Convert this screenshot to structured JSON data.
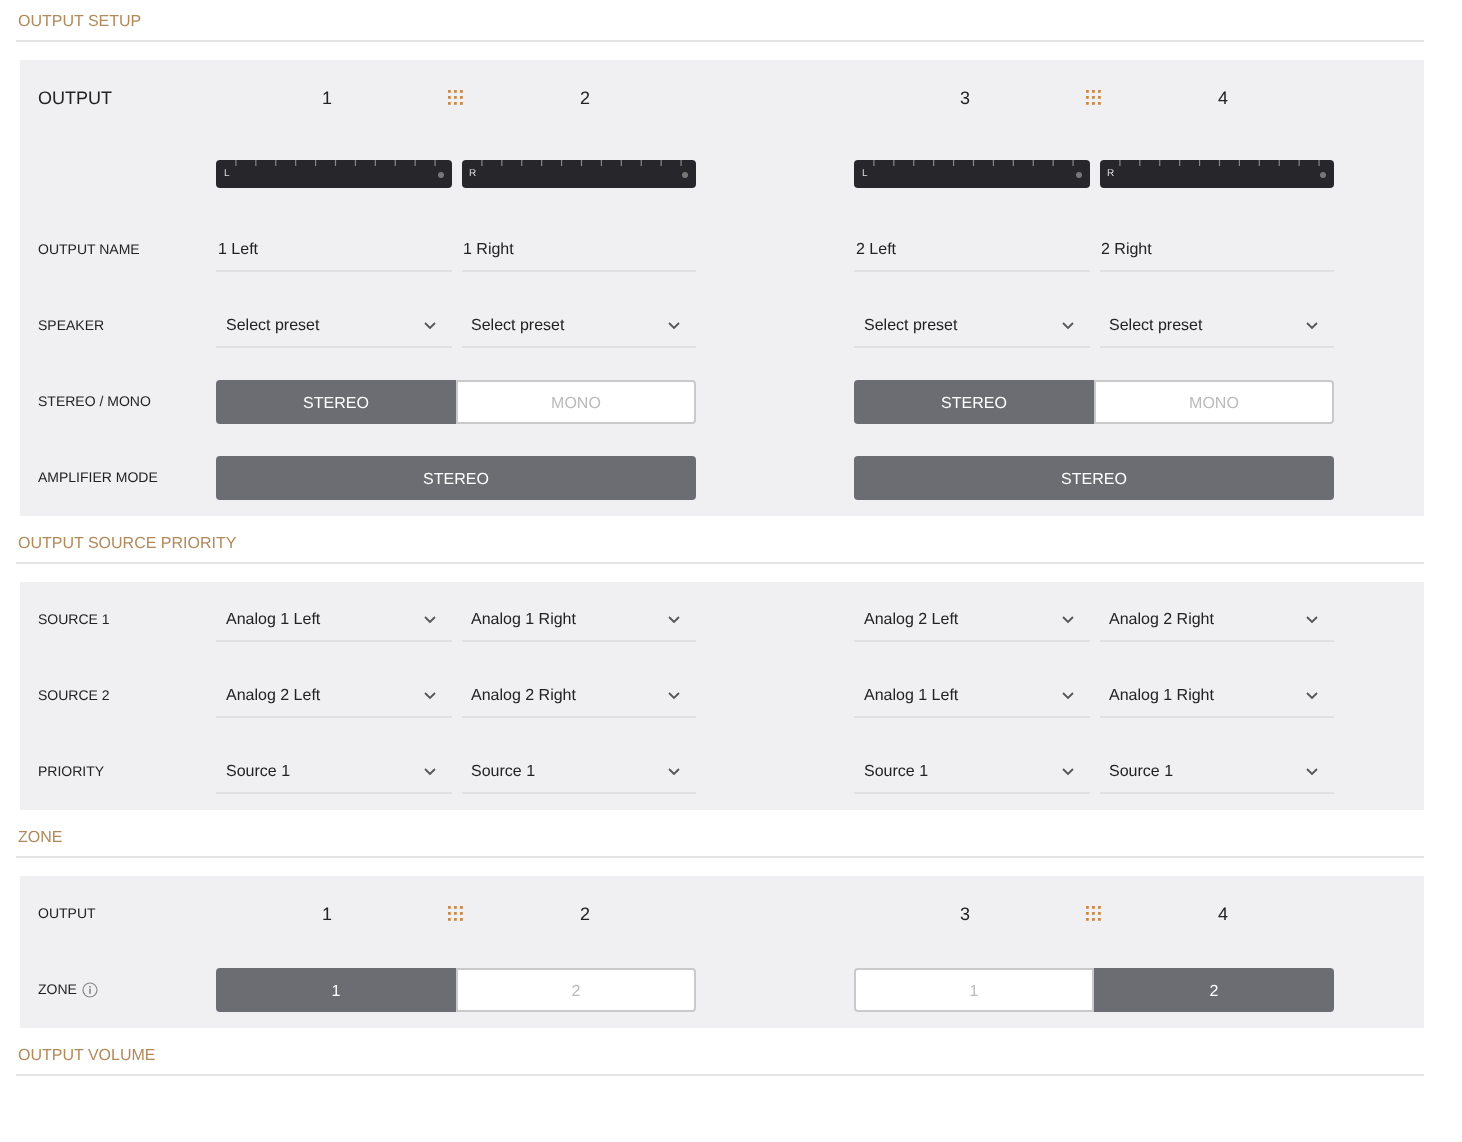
{
  "sections": [
    {
      "title": "OUTPUT SETUP",
      "rows": [
        {
          "kind": "outputs",
          "label": "OUTPUT",
          "large": true,
          "groups": [
            [
              "1",
              "2"
            ],
            [
              "3",
              "4"
            ]
          ]
        },
        {
          "kind": "meters",
          "groups": [
            [
              "L",
              "R"
            ],
            [
              "L",
              "R"
            ]
          ]
        },
        {
          "kind": "text",
          "label": "OUTPUT NAME",
          "groups": [
            [
              "1 Left",
              "1 Right"
            ],
            [
              "2 Left",
              "2 Right"
            ]
          ]
        },
        {
          "kind": "select",
          "label": "SPEAKER",
          "groups": [
            [
              "Select preset",
              "Select preset"
            ],
            [
              "Select preset",
              "Select preset"
            ]
          ]
        },
        {
          "kind": "toggle",
          "label": "STEREO / MONO",
          "groups": [
            [
              {
                "label": "STEREO",
                "selected": true
              },
              {
                "label": "MONO",
                "selected": false
              }
            ],
            [
              {
                "label": "STEREO",
                "selected": true
              },
              {
                "label": "MONO",
                "selected": false
              }
            ]
          ]
        },
        {
          "kind": "button",
          "label": "AMPLIFIER MODE",
          "groups": [
            [
              "STEREO"
            ],
            [
              "STEREO"
            ]
          ]
        }
      ]
    },
    {
      "title": "OUTPUT SOURCE PRIORITY",
      "rows": [
        {
          "kind": "select",
          "label": "SOURCE 1",
          "groups": [
            [
              "Analog 1 Left",
              "Analog 1 Right"
            ],
            [
              "Analog 2 Left",
              "Analog 2 Right"
            ]
          ]
        },
        {
          "kind": "select",
          "label": "SOURCE 2",
          "groups": [
            [
              "Analog 2 Left",
              "Analog 2 Right"
            ],
            [
              "Analog 1 Left",
              "Analog 1 Right"
            ]
          ]
        },
        {
          "kind": "select",
          "label": "PRIORITY",
          "groups": [
            [
              "Source 1",
              "Source 1"
            ],
            [
              "Source 1",
              "Source 1"
            ]
          ]
        }
      ]
    },
    {
      "title": "ZONE",
      "rows": [
        {
          "kind": "outputs",
          "label": "OUTPUT",
          "large": false,
          "groups": [
            [
              "1",
              "2"
            ],
            [
              "3",
              "4"
            ]
          ]
        },
        {
          "kind": "toggle",
          "label": "ZONE",
          "info": true,
          "groups": [
            [
              {
                "label": "1",
                "selected": true
              },
              {
                "label": "2",
                "selected": false
              }
            ],
            [
              {
                "label": "1",
                "selected": false
              },
              {
                "label": "2",
                "selected": true
              }
            ]
          ]
        }
      ]
    },
    {
      "title": "OUTPUT VOLUME"
    }
  ]
}
